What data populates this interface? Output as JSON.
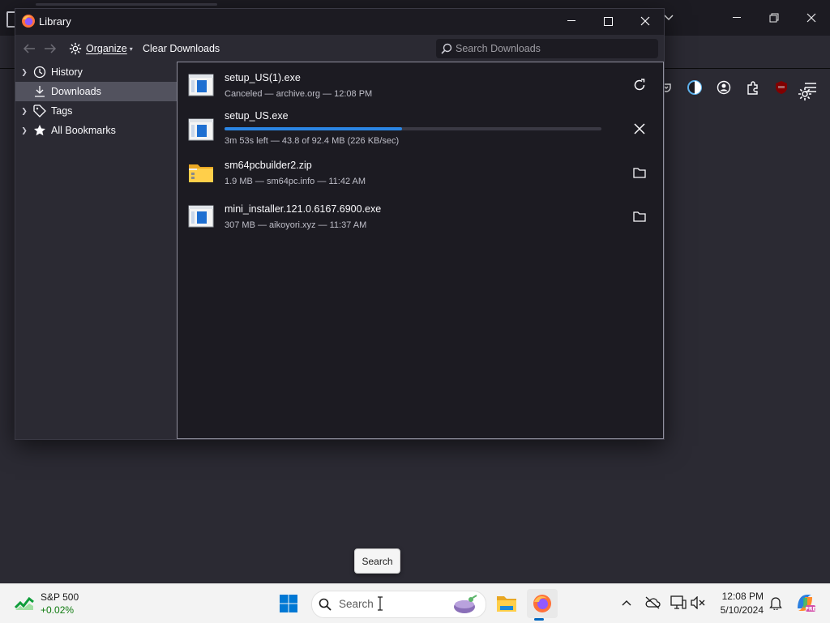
{
  "library": {
    "title": "Library",
    "toolbar": {
      "organize_label": "Organize",
      "clear_label": "Clear Downloads",
      "search_placeholder": "Search Downloads"
    },
    "sidebar": [
      {
        "label": "History",
        "icon": "clock-icon",
        "expandable": true,
        "selected": false
      },
      {
        "label": "Downloads",
        "icon": "download-icon",
        "expandable": false,
        "selected": true
      },
      {
        "label": "Tags",
        "icon": "tag-icon",
        "expandable": true,
        "selected": false
      },
      {
        "label": "All Bookmarks",
        "icon": "star-icon",
        "expandable": true,
        "selected": false
      }
    ],
    "downloads": [
      {
        "name": "setup_US(1).exe",
        "status": "Canceled — archive.org — 12:08 PM",
        "file_icon": "exe-file-icon",
        "action_icon": "retry-icon"
      },
      {
        "name": "setup_US.exe",
        "status": "3m 53s left — 43.8 of 92.4 MB (226 KB/sec)",
        "file_icon": "exe-file-icon",
        "action_icon": "cancel-icon",
        "progress": 0.47
      },
      {
        "name": "sm64pcbuilder2.zip",
        "status": "1.9 MB — sm64pc.info — 11:42 AM",
        "file_icon": "zip-folder-icon",
        "action_icon": "folder-icon"
      },
      {
        "name": "mini_installer.121.0.6167.6900.exe",
        "status": "307 MB — aikoyori.xyz — 11:37 AM",
        "file_icon": "exe-file-icon",
        "action_icon": "folder-icon"
      }
    ]
  },
  "tooltip": {
    "text": "Search"
  },
  "taskbar": {
    "stock": {
      "name": "S&P 500",
      "change": "+0.02%"
    },
    "search_label": "Search",
    "clock": {
      "time": "12:08 PM",
      "date": "5/10/2024"
    }
  },
  "colors": {
    "progress": "#2b86e4",
    "selected_sidebar": "#52525e",
    "stock_positive": "#0f7b0f"
  }
}
